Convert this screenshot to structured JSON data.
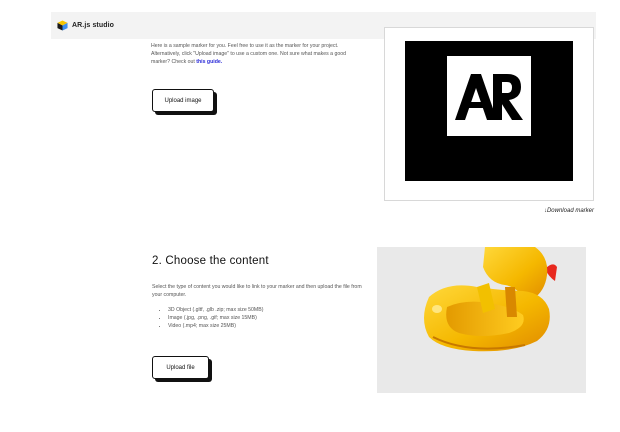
{
  "header": {
    "brand_name": "AR.js studio",
    "logo_icon": "arjs-cube-logo"
  },
  "marker_section": {
    "description_before_link": "Here is a sample marker for you. Feel free to use it as the marker for your project. Alternatively, click \"Upload image\" to use a custom one. Not sure what makes a good marker? Check out ",
    "guide_link_label": "this guide.",
    "upload_button_label": "Upload image",
    "marker_text": "AR",
    "download_label": "Download marker",
    "download_icon": "down-arrow-icon"
  },
  "content_section": {
    "title": "2. Choose the content",
    "description": "Select the type of content you would like to link to your marker and then upload the file from your computer.",
    "content_types": [
      "3D Object (.gltf, .glb .zip; max size 50MB)",
      "Image (.jpg, .png, .gif; max size 15MB)",
      "Video (.mp4; max size 25MB)"
    ],
    "upload_button_label": "Upload file",
    "preview_subject": "3d-rubber-duck-model"
  },
  "colors": {
    "link": "#2a2ad8",
    "topbar": "#f3f3f3",
    "preview_background": "#e9e9e9",
    "duck_yellow": "#f5c400",
    "duck_beak": "#e8281e"
  }
}
